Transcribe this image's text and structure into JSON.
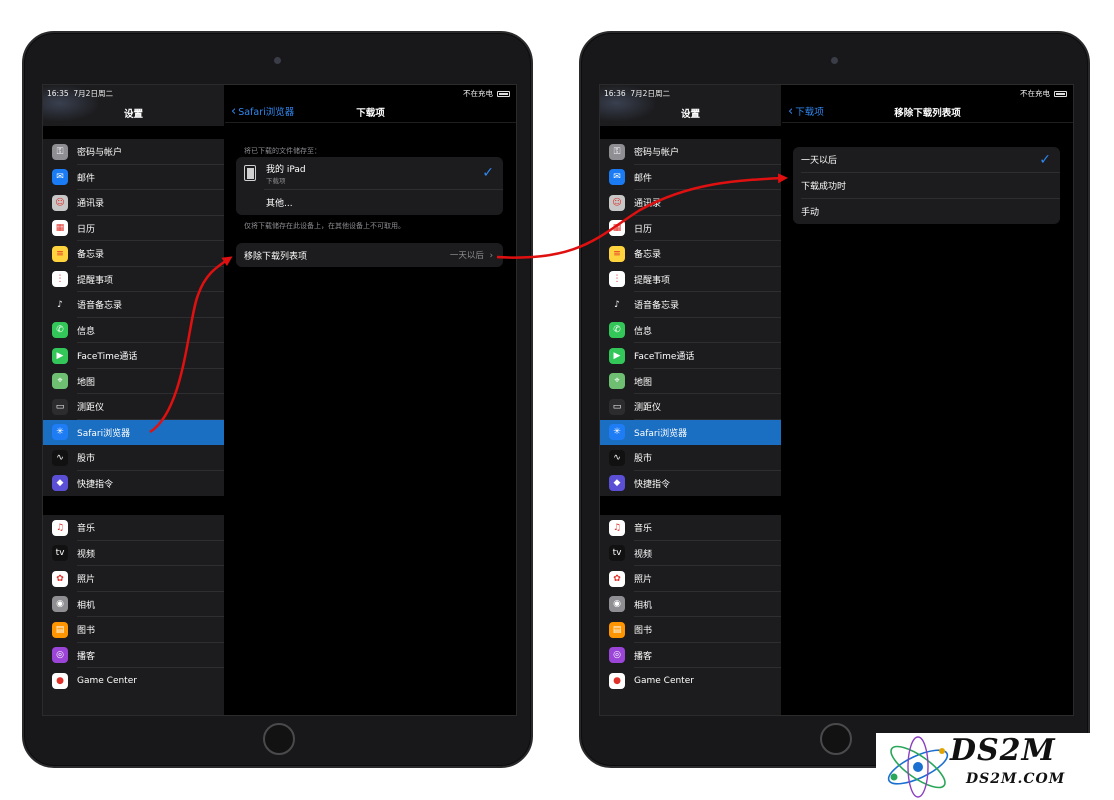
{
  "status_bar": {
    "left_time": "16:35",
    "right_time": "16:36",
    "date": "7月2日周二",
    "charging": "不在充电"
  },
  "sidebar": {
    "title": "设置",
    "group1": [
      {
        "label": "密码与帐户",
        "icon": "key-icon",
        "color": "#8e8e93"
      },
      {
        "label": "邮件",
        "icon": "mail-icon",
        "color": "#1a7bf2"
      },
      {
        "label": "通讯录",
        "icon": "contacts-icon",
        "color": "#c7c7c7"
      },
      {
        "label": "日历",
        "icon": "calendar-icon",
        "color": "#ffffff"
      },
      {
        "label": "备忘录",
        "icon": "notes-icon",
        "color": "#ffd33d"
      },
      {
        "label": "提醒事项",
        "icon": "reminders-icon",
        "color": "#ffffff"
      },
      {
        "label": "语音备忘录",
        "icon": "voice-memos-icon",
        "color": "#1c1c1e"
      },
      {
        "label": "信息",
        "icon": "messages-icon",
        "color": "#33c759"
      },
      {
        "label": "FaceTime通话",
        "icon": "facetime-icon",
        "color": "#33c759"
      },
      {
        "label": "地图",
        "icon": "maps-icon",
        "color": "#6fbf73"
      },
      {
        "label": "测距仪",
        "icon": "measure-icon",
        "color": "#2c2c2e"
      },
      {
        "label": "Safari浏览器",
        "icon": "safari-icon",
        "color": "#1e7cf5"
      },
      {
        "label": "股市",
        "icon": "stocks-icon",
        "color": "#111111"
      },
      {
        "label": "快捷指令",
        "icon": "shortcuts-icon",
        "color": "#5b4fd6"
      }
    ],
    "group2": [
      {
        "label": "音乐",
        "icon": "music-icon",
        "color": "#ffffff"
      },
      {
        "label": "视频",
        "icon": "tv-icon",
        "color": "#111111"
      },
      {
        "label": "照片",
        "icon": "photos-icon",
        "color": "#ffffff"
      },
      {
        "label": "相机",
        "icon": "camera-icon",
        "color": "#8e8e93"
      },
      {
        "label": "图书",
        "icon": "books-icon",
        "color": "#ff9500"
      },
      {
        "label": "播客",
        "icon": "podcasts-icon",
        "color": "#9b45d8"
      },
      {
        "label": "Game Center",
        "icon": "game-center-icon",
        "color": "#ffffff"
      }
    ]
  },
  "screen1": {
    "back_label": "Safari浏览器",
    "title": "下载项",
    "store_caption": "将已下载的文件储存至：",
    "my_ipad": "我的 iPad",
    "my_ipad_sub": "下载项",
    "other": "其他...",
    "footer": "仅将下载储存在此设备上，在其他设备上不可取用。",
    "remove_label": "移除下载列表项",
    "remove_value": "一天以后"
  },
  "screen2": {
    "back_label": "下载项",
    "title": "移除下载列表项",
    "options": [
      "一天以后",
      "下载成功时",
      "手动"
    ]
  },
  "watermark": {
    "title": "DS2M",
    "sub": "DS2M.COM"
  },
  "colors": {
    "accent": "#2f87f0",
    "selected": "#1a6fc3",
    "arrow": "#e01010"
  }
}
